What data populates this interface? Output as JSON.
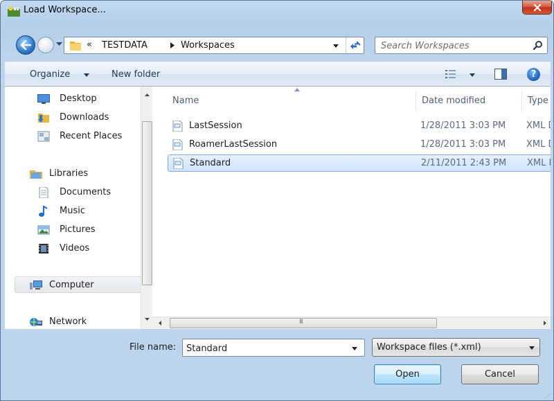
{
  "window": {
    "title": "Load Workspace...",
    "close_icon": "close-icon"
  },
  "address_bar": {
    "overflow_chevron": "«",
    "breadcrumbs": [
      "TESTDATA",
      "Workspaces"
    ]
  },
  "search": {
    "placeholder": "Search Workspaces"
  },
  "toolbar": {
    "organize_label": "Organize",
    "new_folder_label": "New folder"
  },
  "nav_pane": {
    "favorites": [
      {
        "label": "Desktop",
        "icon": "desktop-icon"
      },
      {
        "label": "Downloads",
        "icon": "downloads-folder-icon"
      },
      {
        "label": "Recent Places",
        "icon": "recent-places-icon"
      }
    ],
    "libraries": {
      "label": "Libraries",
      "icon": "libraries-icon",
      "items": [
        {
          "label": "Documents",
          "icon": "documents-icon"
        },
        {
          "label": "Music",
          "icon": "music-icon"
        },
        {
          "label": "Pictures",
          "icon": "pictures-icon"
        },
        {
          "label": "Videos",
          "icon": "videos-icon"
        }
      ]
    },
    "computer": {
      "label": "Computer",
      "icon": "computer-icon",
      "selected": true
    },
    "network": {
      "label": "Network",
      "icon": "network-icon"
    }
  },
  "file_list": {
    "columns": [
      "Name",
      "Date modified",
      "Type"
    ],
    "sort_column": "Name",
    "rows": [
      {
        "name": "LastSession",
        "date_modified": "1/28/2011 3:03 PM",
        "type": "XML D",
        "selected": false
      },
      {
        "name": "RoamerLastSession",
        "date_modified": "1/28/2011 3:03 PM",
        "type": "XML D",
        "selected": false
      },
      {
        "name": "Standard",
        "date_modified": "2/11/2011 2:43 PM",
        "type": "XML D",
        "selected": true
      }
    ]
  },
  "bottom": {
    "file_name_label": "File name:",
    "file_name_value": "Standard",
    "file_type_value": "Workspace files (*.xml)",
    "open_label": "Open",
    "cancel_label": "Cancel",
    "scroll_grip": "III"
  },
  "colors": {
    "frame": "#bcd4ec",
    "selection": "#cfe3fb",
    "selection_border": "#84acdd",
    "close_button": "#c0301b",
    "link_text": "#1e395b"
  }
}
